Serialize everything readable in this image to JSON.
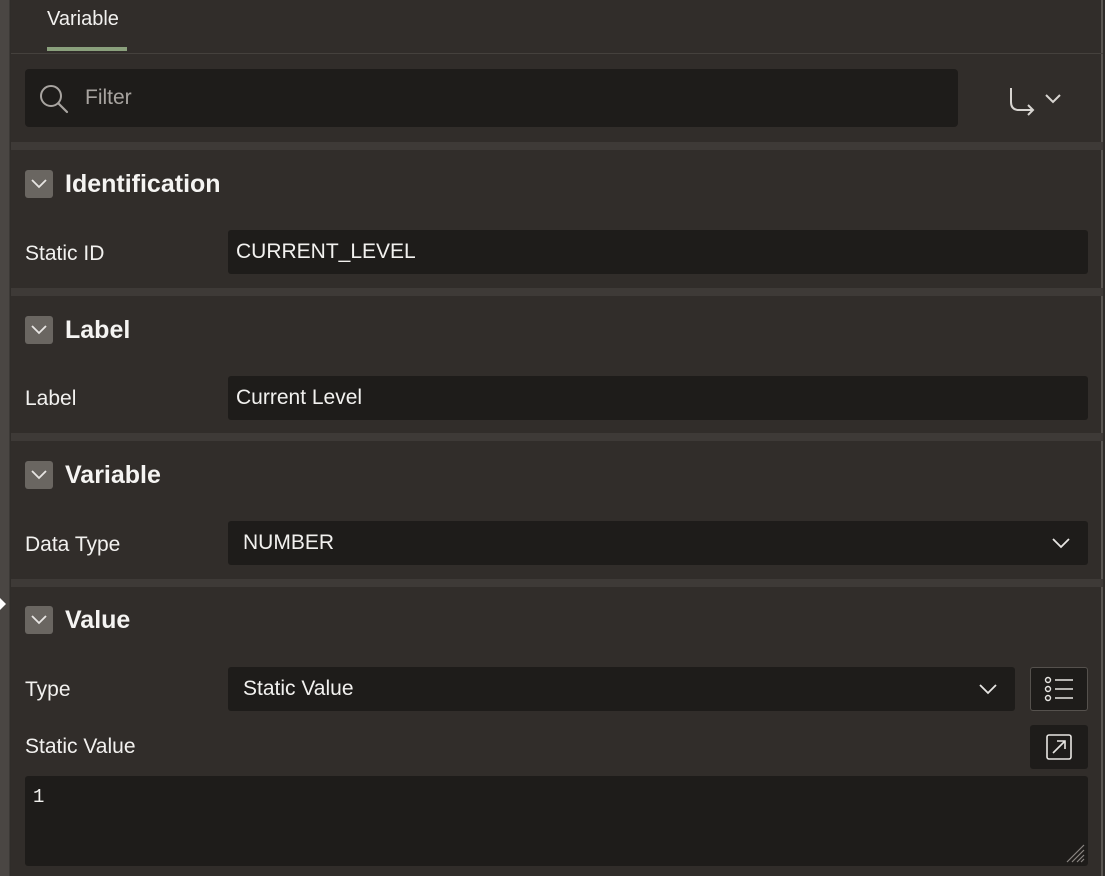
{
  "tabs": [
    {
      "label": "Variable",
      "active": true
    }
  ],
  "filter": {
    "placeholder": "Filter",
    "value": ""
  },
  "goto_button": {
    "icon": "goto-arrow-icon"
  },
  "sections": {
    "identification": {
      "title": "Identification",
      "static_id_label": "Static ID",
      "static_id_value": "CURRENT_LEVEL"
    },
    "label": {
      "title": "Label",
      "label_label": "Label",
      "label_value": "Current Level"
    },
    "variable": {
      "title": "Variable",
      "data_type_label": "Data Type",
      "data_type_value": "NUMBER"
    },
    "value": {
      "title": "Value",
      "type_label": "Type",
      "type_value": "Static Value",
      "static_value_label": "Static Value",
      "static_value": "1"
    }
  },
  "colors": {
    "background": "#312d2a",
    "field_background": "#1e1c1a",
    "tab_underline": "#8aa07c",
    "text": "#f2f1ef"
  }
}
